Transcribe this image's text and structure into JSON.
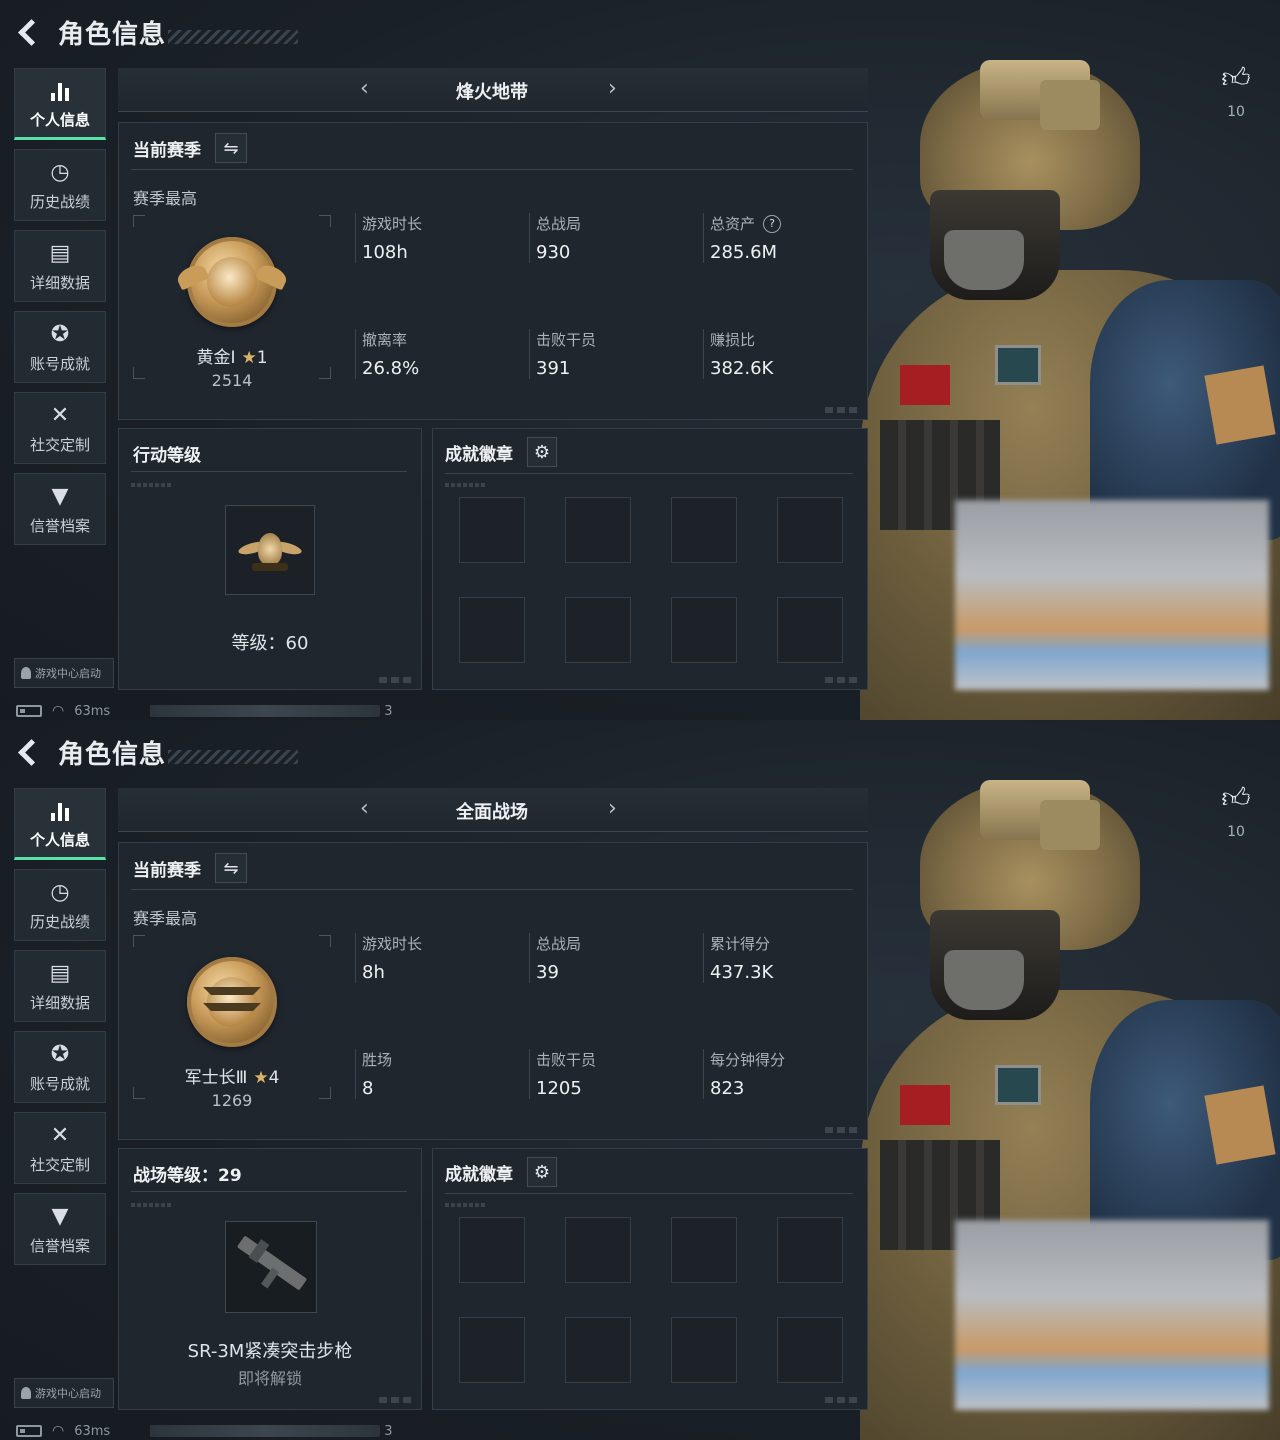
{
  "screens": [
    {
      "title": "角色信息",
      "nav": [
        "个人信息",
        "历史战绩",
        "详细数据",
        "账号成就",
        "社交定制",
        "信誉档案"
      ],
      "nav_icons": [
        "bar-chart-icon",
        "clock-icon",
        "folder-icon",
        "trophy-icon",
        "tools-icon",
        "shield-icon"
      ],
      "launch_badge": "游戏中心启动",
      "ping": "63ms",
      "status_tail": "3",
      "mode": "烽火地带",
      "season_label": "当前赛季",
      "season_best": "赛季最高",
      "rank": {
        "name": "黄金Ⅰ",
        "stars": "1",
        "score": "2514"
      },
      "stats": [
        {
          "label": "游戏时长",
          "value": "108h"
        },
        {
          "label": "总战局",
          "value": "930"
        },
        {
          "label": "总资产",
          "value": "285.6M",
          "help": "?"
        },
        {
          "label": "撤离率",
          "value": "26.8%"
        },
        {
          "label": "击败干员",
          "value": "391"
        },
        {
          "label": "赚损比",
          "value": "382.6K"
        }
      ],
      "level_title": "行动等级",
      "level_text": "等级：60",
      "achievements_title": "成就徽章",
      "likes": "10"
    },
    {
      "title": "角色信息",
      "nav": [
        "个人信息",
        "历史战绩",
        "详细数据",
        "账号成就",
        "社交定制",
        "信誉档案"
      ],
      "launch_badge": "游戏中心启动",
      "ping": "63ms",
      "status_tail": "3",
      "mode": "全面战场",
      "season_label": "当前赛季",
      "season_best": "赛季最高",
      "rank": {
        "name": "军士长Ⅲ",
        "stars": "4",
        "score": "1269"
      },
      "stats": [
        {
          "label": "游戏时长",
          "value": "8h"
        },
        {
          "label": "总战局",
          "value": "39"
        },
        {
          "label": "累计得分",
          "value": "437.3K"
        },
        {
          "label": "胜场",
          "value": "8"
        },
        {
          "label": "击败干员",
          "value": "1205"
        },
        {
          "label": "每分钟得分",
          "value": "823"
        }
      ],
      "level_title": "战场等级：29",
      "weapon_name": "SR-3M紧凑突击步枪",
      "weapon_status": "即将解锁",
      "achievements_title": "成就徽章",
      "likes": "10"
    }
  ],
  "colors": {
    "accent": "#57e0a8",
    "panel": "#1f262d",
    "background": "#1a2027"
  }
}
